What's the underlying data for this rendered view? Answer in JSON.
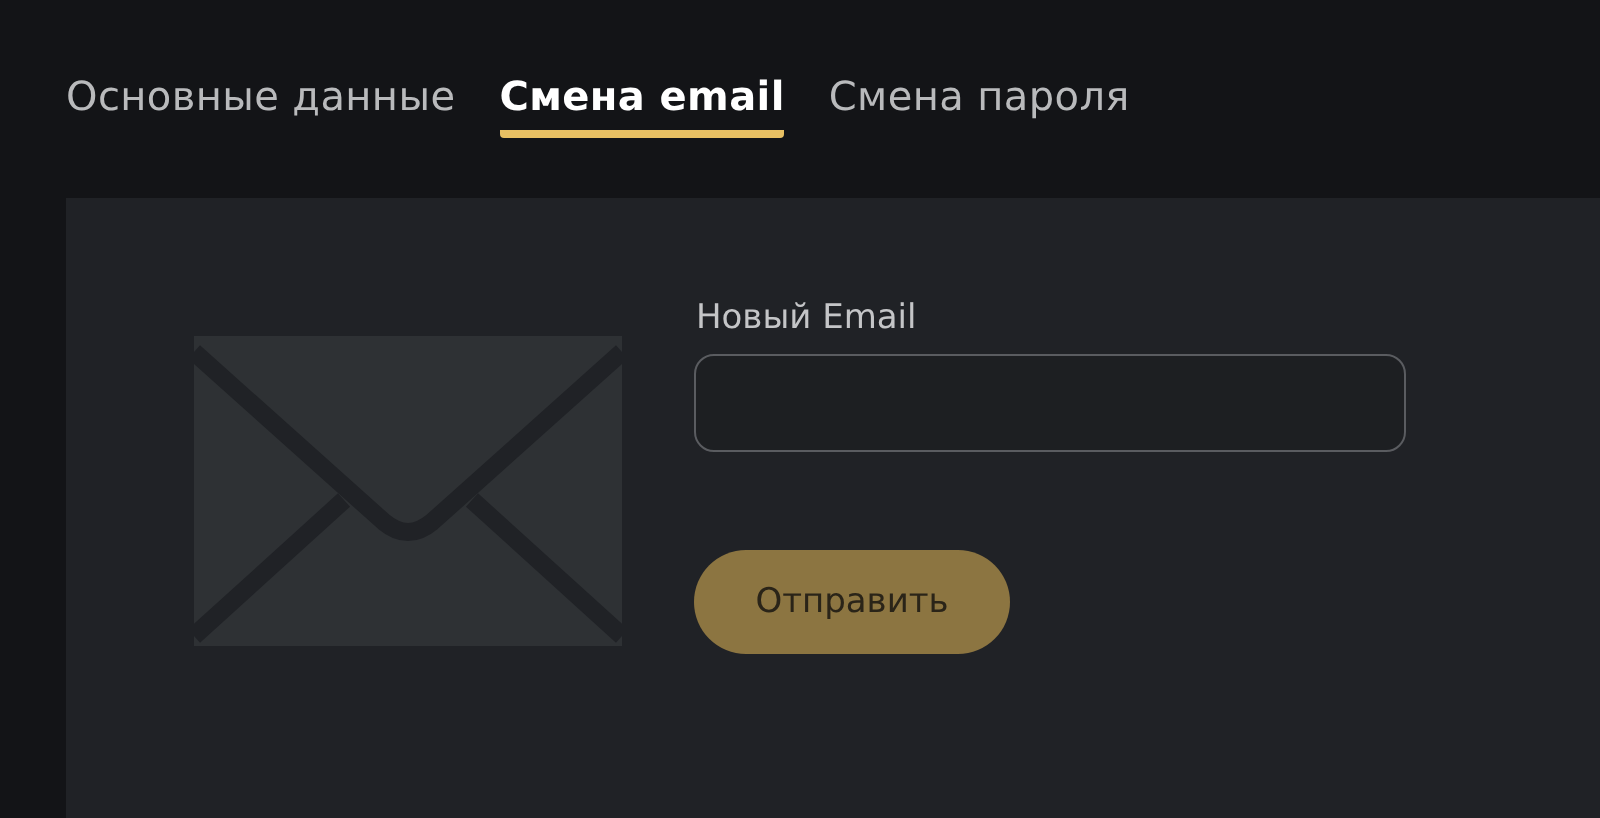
{
  "tabs": [
    {
      "label": "Основные данные",
      "selected": false
    },
    {
      "label": "Смена email",
      "selected": true
    },
    {
      "label": "Смена пароля",
      "selected": false
    }
  ],
  "form": {
    "field_label": "Новый Email",
    "submit": "Отправить"
  }
}
